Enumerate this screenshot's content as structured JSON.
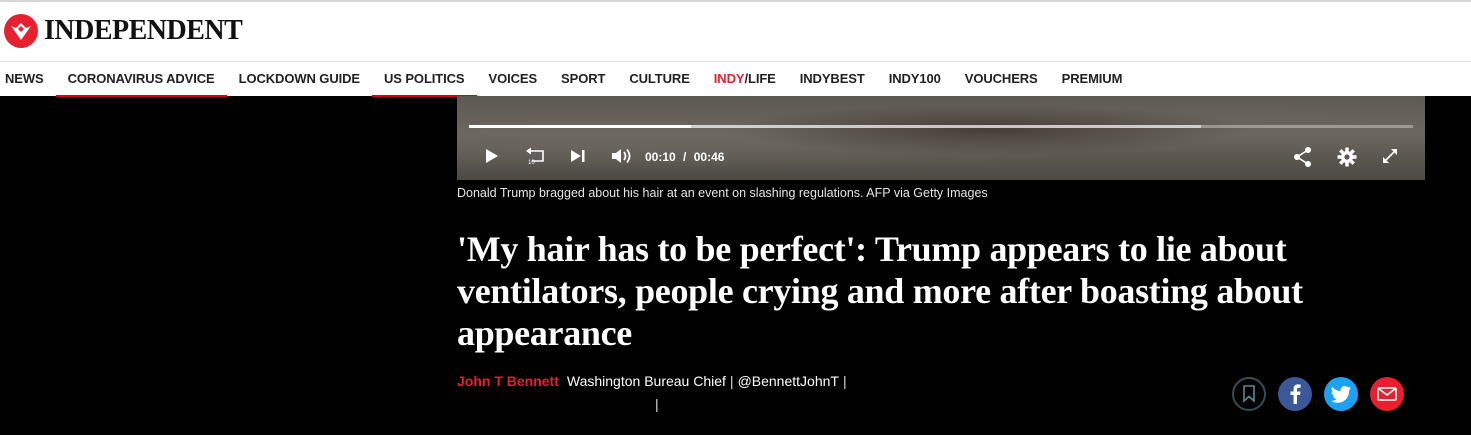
{
  "brand": {
    "name": "INDEPENDENT",
    "accent": "#e6202e"
  },
  "nav": {
    "items": [
      {
        "label": "NEWS"
      },
      {
        "label": "CORONAVIRUS ADVICE"
      },
      {
        "label": "LOCKDOWN GUIDE"
      },
      {
        "label": "US POLITICS"
      },
      {
        "label": "VOICES"
      },
      {
        "label": "SPORT"
      },
      {
        "label": "CULTURE"
      },
      {
        "label_a": "INDY",
        "label_b": "/LIFE"
      },
      {
        "label": "INDYBEST"
      },
      {
        "label": "INDY100"
      },
      {
        "label": "VOUCHERS"
      },
      {
        "label": "PREMIUM"
      }
    ]
  },
  "video": {
    "current_time": "00:10",
    "duration": "00:46",
    "time_separator": "/",
    "progress_fraction": 0.2347,
    "buffered_fraction": 0.7755,
    "icons": [
      "play-icon",
      "replay-10-icon",
      "skip-next-icon",
      "volume-icon",
      "share-icon",
      "settings-icon",
      "fullscreen-icon"
    ]
  },
  "article": {
    "caption": "Donald Trump bragged about his hair at an event on slashing regulations. AFP via Getty Images",
    "headline": "'My hair has to be perfect': Trump appears to lie about ventilators, people crying and more after boasting about appearance",
    "author": "John T Bennett",
    "role": "Washington Bureau Chief",
    "handle": "@BennettJohnT",
    "separator": "|"
  },
  "social": {
    "colors": {
      "bookmark": "#2f4f5a",
      "facebook": "#3b5998",
      "twitter": "#1da1f2",
      "email": "#e6202e"
    }
  }
}
